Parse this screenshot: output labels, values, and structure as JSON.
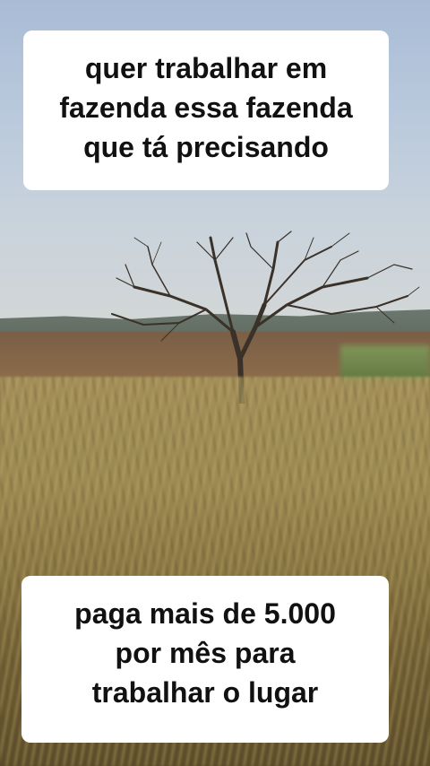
{
  "captions": {
    "top": {
      "lines": [
        "quer trabalhar em",
        "fazenda essa fazenda",
        "que tá precisando"
      ]
    },
    "bottom": {
      "lines": [
        "paga mais de 5.000",
        "por mês para",
        "trabalhar o lugar"
      ]
    }
  },
  "scene": {
    "subject": "tree-icon",
    "sky_color": "#b9c9dc",
    "field_color": "#8e7a4e"
  }
}
